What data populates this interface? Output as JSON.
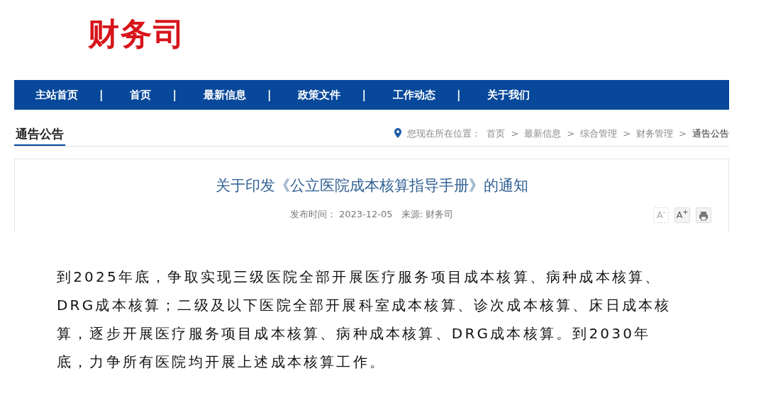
{
  "logo": "财务司",
  "nav": [
    {
      "label": "主站首页",
      "separator": "|"
    },
    {
      "label": "首页",
      "separator": "|"
    },
    {
      "label": "最新信息",
      "separator": "|"
    },
    {
      "label": "政策文件",
      "separator": "|"
    },
    {
      "label": "工作动态",
      "separator": "|"
    },
    {
      "label": "关于我们"
    }
  ],
  "section_title": "通告公告",
  "breadcrumb": {
    "label": "您现在所在位置：",
    "items": [
      {
        "text": "首页",
        "current": false
      },
      {
        "separator": ">",
        "text": "最新信息",
        "current": false
      },
      {
        "separator": ">",
        "text": "综合管理",
        "current": false
      },
      {
        "separator": ">",
        "text": "财务管理",
        "current": false
      },
      {
        "separator": ">",
        "text": "通告公告",
        "current": true
      }
    ]
  },
  "article": {
    "title": "关于印发《公立医院成本核算指导手册》的通知",
    "date_label": "发布时间：",
    "date": "2023-12-05",
    "source": "来源: 财务司",
    "tools": [
      {
        "kind": "font",
        "label": "A",
        "sign": "-",
        "disabled": true
      },
      {
        "kind": "font",
        "label": "A",
        "sign": "+",
        "disabled": false
      },
      {
        "kind": "print",
        "disabled": false
      }
    ]
  },
  "excerpt": [
    "到2025年底，争取实现三级医院全部开展医疗服务项目成本核算、病种成本核算、",
    "DRG成本核算；二级及以下医院全部开展科室成本核算、诊次成本核算、床日成本核",
    "算，逐步开展医疗服务项目成本核算、病种成本核算、DRG成本核算。到2030年",
    "底，力争所有医院均开展上述成本核算工作。"
  ]
}
